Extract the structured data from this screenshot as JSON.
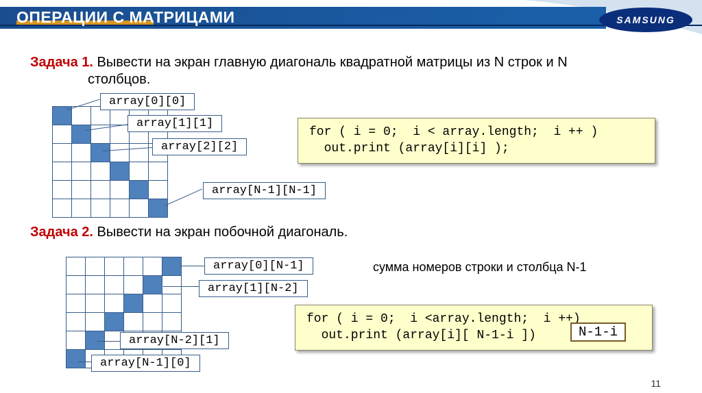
{
  "slide": {
    "title": "ОПЕРАЦИИ С МАТРИЦАМИ",
    "logo_text": "SAMSUNG",
    "page_number": "11"
  },
  "task1": {
    "label": "Задача 1.",
    "text_line1": " Вывести на экран главную диагональ квадратной матрицы из N строк и N",
    "text_line2": "столбцов."
  },
  "callouts1": {
    "c1": "array[0][0]",
    "c2": "array[1][1]",
    "c3": "array[2][2]",
    "c4": "array[N-1][N-1]"
  },
  "code1": {
    "line1": "for ( i = 0;  i < array.length;  i ++ )",
    "line2": "  out.print (array[i][i] );"
  },
  "task2": {
    "label": "Задача 2.",
    "text": " Вывести на экран побочной диагональ."
  },
  "sum_note": "сумма номеров строки и столбца N-1",
  "callouts2": {
    "c5": "array[0][N-1]",
    "c6": "array[1][N-2]",
    "c7": "array[N-2][1]",
    "c8": "array[N-1][0]"
  },
  "code2": {
    "line1": "for ( i = 0;  i <array.length;  i ++)",
    "line2": "  out.print (array[i][ N-1-i ])"
  },
  "highlight": "N-1-i"
}
